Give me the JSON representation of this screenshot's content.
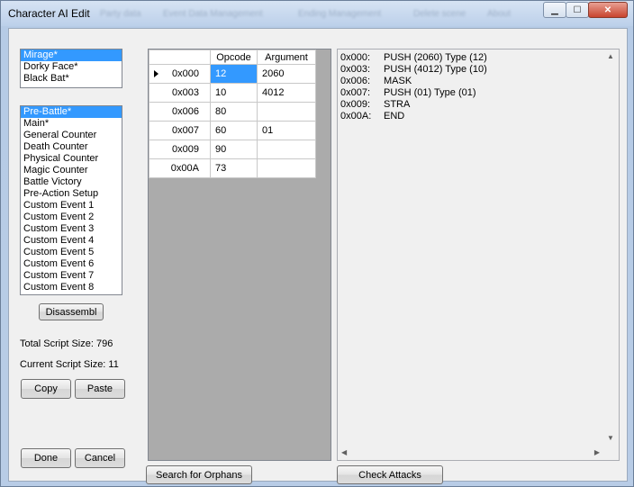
{
  "window": {
    "title": "Character AI Edit",
    "minimize_glyph": "▁",
    "maximize_glyph": "☐",
    "close_glyph": "✕",
    "background_menu_ghost": [
      "Party data",
      "Event Data Management",
      "Ending Management",
      "Delete scene",
      "About"
    ]
  },
  "characters": {
    "items": [
      "Mirage*",
      "Dorky Face*",
      "Black Bat*"
    ],
    "selected_index": 0
  },
  "scripts": {
    "items": [
      "Pre-Battle*",
      "Main*",
      "General Counter",
      "Death Counter",
      "Physical Counter",
      "Magic Counter",
      "Battle Victory",
      "Pre-Action Setup",
      "Custom Event 1",
      "Custom Event 2",
      "Custom Event 3",
      "Custom Event 4",
      "Custom Event 5",
      "Custom Event 6",
      "Custom Event 7",
      "Custom Event 8"
    ],
    "selected_index": 0
  },
  "buttons": {
    "disassemble": "Disassembl",
    "copy": "Copy",
    "paste": "Paste",
    "done": "Done",
    "cancel": "Cancel",
    "search_orphans": "Search for Orphans",
    "check_attacks": "Check Attacks"
  },
  "stats": {
    "total_script_size": "Total Script Size: 796",
    "current_script_size": "Current Script Size: 11"
  },
  "grid": {
    "headers": [
      "",
      "Opcode",
      "Argument"
    ],
    "rows": [
      {
        "addr": "0x000",
        "opcode": "12",
        "argument": "2060",
        "current": true
      },
      {
        "addr": "0x003",
        "opcode": "10",
        "argument": "4012",
        "current": false
      },
      {
        "addr": "0x006",
        "opcode": "80",
        "argument": "",
        "current": false
      },
      {
        "addr": "0x007",
        "opcode": "60",
        "argument": "01",
        "current": false
      },
      {
        "addr": "0x009",
        "opcode": "90",
        "argument": "",
        "current": false
      },
      {
        "addr": "0x00A",
        "opcode": "73",
        "argument": "",
        "current": false
      }
    ]
  },
  "disassembly": [
    {
      "addr": "0x000:",
      "text": "PUSH (2060) Type (12)"
    },
    {
      "addr": "0x003:",
      "text": "PUSH (4012) Type (10)"
    },
    {
      "addr": "0x006:",
      "text": "MASK"
    },
    {
      "addr": "0x007:",
      "text": "PUSH (01) Type (01)"
    },
    {
      "addr": "0x009:",
      "text": "STRA"
    },
    {
      "addr": "0x00A:",
      "text": "END"
    }
  ],
  "scrollbar_glyphs": {
    "up": "▲",
    "down": "▼",
    "left": "◀",
    "right": "▶"
  }
}
